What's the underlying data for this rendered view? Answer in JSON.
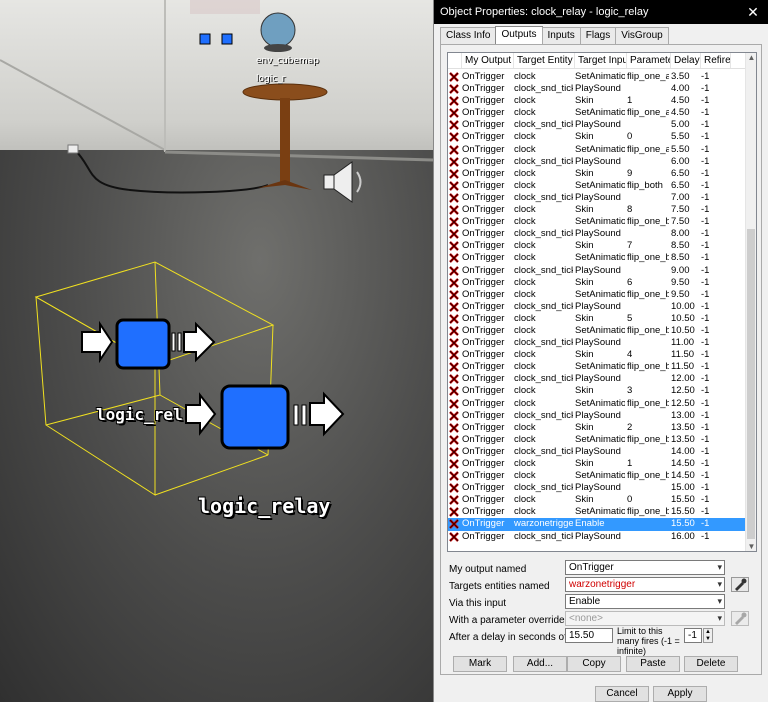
{
  "window": {
    "title": "Object Properties: clock_relay - logic_relay",
    "close_glyph": "✕"
  },
  "tabs": [
    {
      "label": "Class Info",
      "active": false
    },
    {
      "label": "Outputs",
      "active": true
    },
    {
      "label": "Inputs",
      "active": false
    },
    {
      "label": "Flags",
      "active": false
    },
    {
      "label": "VisGroup",
      "active": false
    }
  ],
  "grid": {
    "columns": [
      "My Output >",
      "Target Entity",
      "Target Input",
      "Parameter",
      "Delay",
      "Refires"
    ],
    "rows": [
      [
        "OnTrigger",
        "clock",
        "SetAnimation",
        "flip_one_a",
        "3.50",
        "-1"
      ],
      [
        "OnTrigger",
        "clock_snd_tick",
        "PlaySound",
        "",
        "4.00",
        "-1"
      ],
      [
        "OnTrigger",
        "clock",
        "Skin",
        "1",
        "4.50",
        "-1"
      ],
      [
        "OnTrigger",
        "clock",
        "SetAnimation",
        "flip_one_a",
        "4.50",
        "-1"
      ],
      [
        "OnTrigger",
        "clock_snd_tick",
        "PlaySound",
        "",
        "5.00",
        "-1"
      ],
      [
        "OnTrigger",
        "clock",
        "Skin",
        "0",
        "5.50",
        "-1"
      ],
      [
        "OnTrigger",
        "clock",
        "SetAnimation",
        "flip_one_a",
        "5.50",
        "-1"
      ],
      [
        "OnTrigger",
        "clock_snd_tick",
        "PlaySound",
        "",
        "6.00",
        "-1"
      ],
      [
        "OnTrigger",
        "clock",
        "Skin",
        "9",
        "6.50",
        "-1"
      ],
      [
        "OnTrigger",
        "clock",
        "SetAnimation",
        "flip_both",
        "6.50",
        "-1"
      ],
      [
        "OnTrigger",
        "clock_snd_tick",
        "PlaySound",
        "",
        "7.00",
        "-1"
      ],
      [
        "OnTrigger",
        "clock",
        "Skin",
        "8",
        "7.50",
        "-1"
      ],
      [
        "OnTrigger",
        "clock",
        "SetAnimation",
        "flip_one_b",
        "7.50",
        "-1"
      ],
      [
        "OnTrigger",
        "clock_snd_tick",
        "PlaySound",
        "",
        "8.00",
        "-1"
      ],
      [
        "OnTrigger",
        "clock",
        "Skin",
        "7",
        "8.50",
        "-1"
      ],
      [
        "OnTrigger",
        "clock",
        "SetAnimation",
        "flip_one_b",
        "8.50",
        "-1"
      ],
      [
        "OnTrigger",
        "clock_snd_tick",
        "PlaySound",
        "",
        "9.00",
        "-1"
      ],
      [
        "OnTrigger",
        "clock",
        "Skin",
        "6",
        "9.50",
        "-1"
      ],
      [
        "OnTrigger",
        "clock",
        "SetAnimation",
        "flip_one_b",
        "9.50",
        "-1"
      ],
      [
        "OnTrigger",
        "clock_snd_tick",
        "PlaySound",
        "",
        "10.00",
        "-1"
      ],
      [
        "OnTrigger",
        "clock",
        "Skin",
        "5",
        "10.50",
        "-1"
      ],
      [
        "OnTrigger",
        "clock",
        "SetAnimation",
        "flip_one_b",
        "10.50",
        "-1"
      ],
      [
        "OnTrigger",
        "clock_snd_tick",
        "PlaySound",
        "",
        "11.00",
        "-1"
      ],
      [
        "OnTrigger",
        "clock",
        "Skin",
        "4",
        "11.50",
        "-1"
      ],
      [
        "OnTrigger",
        "clock",
        "SetAnimation",
        "flip_one_b",
        "11.50",
        "-1"
      ],
      [
        "OnTrigger",
        "clock_snd_tick",
        "PlaySound",
        "",
        "12.00",
        "-1"
      ],
      [
        "OnTrigger",
        "clock",
        "Skin",
        "3",
        "12.50",
        "-1"
      ],
      [
        "OnTrigger",
        "clock",
        "SetAnimation",
        "flip_one_b",
        "12.50",
        "-1"
      ],
      [
        "OnTrigger",
        "clock_snd_tick",
        "PlaySound",
        "",
        "13.00",
        "-1"
      ],
      [
        "OnTrigger",
        "clock",
        "Skin",
        "2",
        "13.50",
        "-1"
      ],
      [
        "OnTrigger",
        "clock",
        "SetAnimation",
        "flip_one_b",
        "13.50",
        "-1"
      ],
      [
        "OnTrigger",
        "clock_snd_tick",
        "PlaySound",
        "",
        "14.00",
        "-1"
      ],
      [
        "OnTrigger",
        "clock",
        "Skin",
        "1",
        "14.50",
        "-1"
      ],
      [
        "OnTrigger",
        "clock",
        "SetAnimation",
        "flip_one_b",
        "14.50",
        "-1"
      ],
      [
        "OnTrigger",
        "clock_snd_tick",
        "PlaySound",
        "",
        "15.00",
        "-1"
      ],
      [
        "OnTrigger",
        "clock",
        "Skin",
        "0",
        "15.50",
        "-1"
      ],
      [
        "OnTrigger",
        "clock",
        "SetAnimation",
        "flip_one_b",
        "15.50",
        "-1"
      ],
      [
        "OnTrigger",
        "warzonetrigger",
        "Enable",
        "",
        "15.50",
        "-1"
      ],
      [
        "OnTrigger",
        "clock_snd_tick",
        "PlaySound",
        "",
        "16.00",
        "-1"
      ]
    ],
    "selected_row": 37
  },
  "form": {
    "output_label": "My output named",
    "output_value": "OnTrigger",
    "target_label": "Targets entities named",
    "target_value": "warzonetrigger",
    "input_label": "Via this input",
    "input_value": "Enable",
    "param_label": "With a parameter override of",
    "param_value": "<none>",
    "delay_label": "After a delay in seconds of",
    "delay_value": "15.50",
    "limit_label": "Limit to this many fires (-1 = infinite)",
    "limit_value": "-1"
  },
  "buttons": {
    "mark": "Mark",
    "add": "Add...",
    "copy": "Copy",
    "paste": "Paste",
    "delete": "Delete",
    "cancel": "Cancel",
    "apply": "Apply"
  },
  "viewport": {
    "entity_label_short": "logic_rel",
    "entity_label": "logic_relay",
    "cubemap_label": "env_cubemap",
    "small_label": "logic_r"
  },
  "colors": {
    "selection": "#3399ff",
    "entity_blue": "#1f6fff",
    "bbox_yellow": "#f0e020",
    "error_red": "#d00000"
  }
}
